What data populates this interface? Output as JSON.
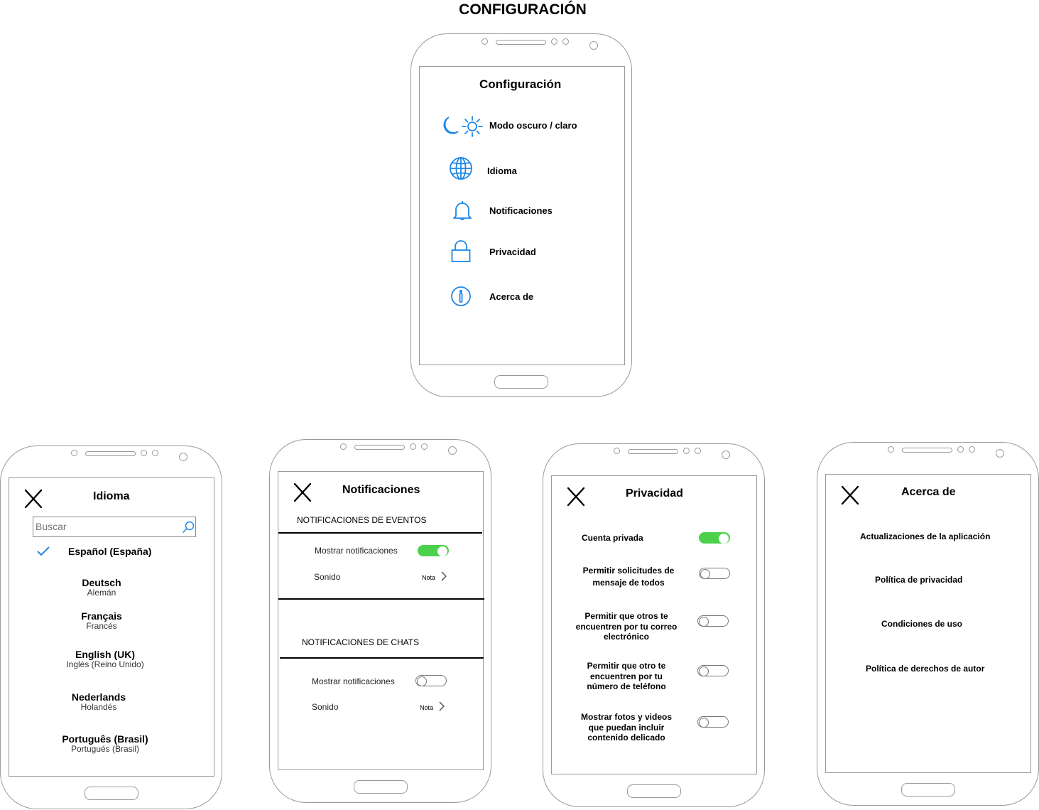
{
  "header": {
    "title": "CONFIGURACIÓN"
  },
  "main_screen": {
    "title": "Configuración",
    "items": [
      {
        "label": "Modo oscuro / claro",
        "icon": "moon-sun-icon"
      },
      {
        "label": "Idioma",
        "icon": "globe-icon"
      },
      {
        "label": "Notificaciones",
        "icon": "bell-icon"
      },
      {
        "label": "Privacidad",
        "icon": "lock-icon"
      },
      {
        "label": "Acerca de",
        "icon": "info-icon"
      }
    ]
  },
  "language_screen": {
    "title": "Idioma",
    "search_placeholder": "Buscar",
    "selected": {
      "name": "Español (España)"
    },
    "languages": [
      {
        "name": "Deutsch",
        "native": "Alemán"
      },
      {
        "name": "Français",
        "native": "Francés"
      },
      {
        "name": "English (UK)",
        "native": "Inglés (Reino Unido)"
      },
      {
        "name": "Nederlands",
        "native": "Holandés"
      },
      {
        "name": "Português (Brasil)",
        "native": "Portugués (Brasil)"
      }
    ]
  },
  "notifications_screen": {
    "title": "Notificaciones",
    "events": {
      "header": "NOTIFICACIONES DE EVENTOS",
      "show_label": "Mostrar notificaciones",
      "show_on": true,
      "sound_label": "Sonido",
      "sound_value": "Nota"
    },
    "chats": {
      "header": "NOTIFICACIONES DE CHATS",
      "show_label": "Mostrar notificaciones",
      "show_on": false,
      "sound_label": "Sonido",
      "sound_value": "Nota"
    }
  },
  "privacy_screen": {
    "title": "Privacidad",
    "options": [
      {
        "label": "Cuenta privada",
        "on": true
      },
      {
        "label": "Permitir solicitudes de mensaje de todos",
        "on": false
      },
      {
        "label": "Permitir que otros te encuentren por tu correo electrónico",
        "on": false
      },
      {
        "label": "Permitir que otro te encuentren por tu número de teléfono",
        "on": false
      },
      {
        "label": "Mostrar fotos y videos que puedan incluir contenido delicado",
        "on": false
      }
    ]
  },
  "about_screen": {
    "title": "Acerca de",
    "items": [
      "Actualizaciones de la aplicación",
      "Política de privacidad",
      "Condiciones de uso",
      "Política de derechos de autor"
    ]
  },
  "colors": {
    "accent": "#1e88e5",
    "toggle_on": "#4cd14c",
    "outline": "#9a9a9a"
  }
}
